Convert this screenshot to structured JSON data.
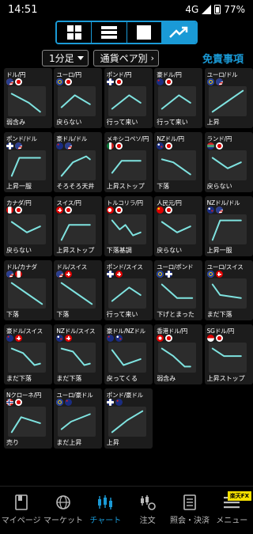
{
  "statusbar": {
    "time": "14:51",
    "network": "4G",
    "battery": "77%"
  },
  "filters": {
    "timeframe": "1分足",
    "sort": "通貨ペア別",
    "notes_label": "免責事項"
  },
  "colors": {
    "accent": "#1a9ad6",
    "line": "#7fe3e0",
    "card": "#1c1c1c",
    "chart_bg": "#2c2c2c"
  },
  "pairs": [
    {
      "name": "ドル/円",
      "flags": [
        "us",
        "jp"
      ],
      "status": "弱含み",
      "trend": [
        [
          0.1,
          0.25
        ],
        [
          0.55,
          0.55
        ],
        [
          0.85,
          0.85
        ]
      ]
    },
    {
      "name": "ユーロ/円",
      "flags": [
        "eu",
        "jp"
      ],
      "status": "戻らない",
      "trend": [
        [
          0.1,
          0.7
        ],
        [
          0.45,
          0.3
        ],
        [
          0.85,
          0.6
        ]
      ]
    },
    {
      "name": "ポンド/円",
      "flags": [
        "gb",
        "jp"
      ],
      "status": "行って来い",
      "trend": [
        [
          0.1,
          0.75
        ],
        [
          0.55,
          0.3
        ],
        [
          0.85,
          0.55
        ]
      ]
    },
    {
      "name": "豪ドル/円",
      "flags": [
        "au",
        "jp"
      ],
      "status": "行って来い",
      "trend": [
        [
          0.1,
          0.75
        ],
        [
          0.55,
          0.3
        ],
        [
          0.85,
          0.55
        ]
      ]
    },
    {
      "name": "ユーロ/ドル",
      "flags": [
        "eu",
        "us"
      ],
      "status": "上昇",
      "trend": [
        [
          0.1,
          0.85
        ],
        [
          0.5,
          0.5
        ],
        [
          0.9,
          0.15
        ]
      ]
    },
    {
      "name": "ポンド/ドル",
      "flags": [
        "gb",
        "us"
      ],
      "status": "上昇一服",
      "trend": [
        [
          0.1,
          0.85
        ],
        [
          0.3,
          0.25
        ],
        [
          0.85,
          0.25
        ]
      ]
    },
    {
      "name": "豪ドル/ドル",
      "flags": [
        "au",
        "us"
      ],
      "status": "そろそろ天井",
      "trend": [
        [
          0.1,
          0.85
        ],
        [
          0.4,
          0.4
        ],
        [
          0.75,
          0.2
        ],
        [
          0.85,
          0.3
        ]
      ]
    },
    {
      "name": "メキシコペソ/円",
      "flags": [
        "mx",
        "jp"
      ],
      "status": "上昇ストップ",
      "trend": [
        [
          0.1,
          0.75
        ],
        [
          0.35,
          0.35
        ],
        [
          0.85,
          0.35
        ]
      ]
    },
    {
      "name": "NZドル/円",
      "flags": [
        "nz",
        "jp"
      ],
      "status": "下落",
      "trend": [
        [
          0.1,
          0.3
        ],
        [
          0.4,
          0.4
        ],
        [
          0.85,
          0.8
        ]
      ]
    },
    {
      "name": "ランド/円",
      "flags": [
        "za",
        "jp"
      ],
      "status": "戻らない",
      "trend": [
        [
          0.1,
          0.25
        ],
        [
          0.5,
          0.6
        ],
        [
          0.85,
          0.4
        ]
      ]
    },
    {
      "name": "カナダ/円",
      "flags": [
        "ca",
        "jp"
      ],
      "status": "戻らない",
      "trend": [
        [
          0.1,
          0.25
        ],
        [
          0.5,
          0.6
        ],
        [
          0.85,
          0.4
        ]
      ]
    },
    {
      "name": "スイス/円",
      "flags": [
        "ch",
        "jp"
      ],
      "status": "上昇ストップ",
      "trend": [
        [
          0.1,
          0.85
        ],
        [
          0.3,
          0.35
        ],
        [
          0.85,
          0.35
        ]
      ]
    },
    {
      "name": "トルコリラ/円",
      "flags": [
        "tr",
        "jp"
      ],
      "status": "下落基調",
      "trend": [
        [
          0.1,
          0.2
        ],
        [
          0.3,
          0.5
        ],
        [
          0.45,
          0.35
        ],
        [
          0.65,
          0.7
        ],
        [
          0.85,
          0.6
        ]
      ]
    },
    {
      "name": "人民元/円",
      "flags": [
        "cn",
        "jp"
      ],
      "status": "戻らない",
      "trend": [
        [
          0.1,
          0.25
        ],
        [
          0.5,
          0.6
        ],
        [
          0.85,
          0.4
        ]
      ]
    },
    {
      "name": "NZドル/ドル",
      "flags": [
        "nz",
        "us"
      ],
      "status": "上昇一服",
      "trend": [
        [
          0.1,
          0.85
        ],
        [
          0.3,
          0.2
        ],
        [
          0.85,
          0.2
        ]
      ]
    },
    {
      "name": "ドル/カナダ",
      "flags": [
        "us",
        "ca"
      ],
      "status": "下落",
      "trend": [
        [
          0.1,
          0.15
        ],
        [
          0.5,
          0.5
        ],
        [
          0.9,
          0.85
        ]
      ]
    },
    {
      "name": "ドル/スイス",
      "flags": [
        "us",
        "ch"
      ],
      "status": "下落",
      "trend": [
        [
          0.1,
          0.15
        ],
        [
          0.5,
          0.5
        ],
        [
          0.9,
          0.85
        ]
      ]
    },
    {
      "name": "ポンド/スイス",
      "flags": [
        "gb",
        "ch"
      ],
      "status": "行って来い",
      "trend": [
        [
          0.1,
          0.75
        ],
        [
          0.55,
          0.3
        ],
        [
          0.85,
          0.55
        ]
      ]
    },
    {
      "name": "ユーロ/ポンド",
      "flags": [
        "eu",
        "gb"
      ],
      "status": "下げとまった",
      "trend": [
        [
          0.1,
          0.2
        ],
        [
          0.5,
          0.65
        ],
        [
          0.9,
          0.65
        ]
      ]
    },
    {
      "name": "ユーロ/スイス",
      "flags": [
        "eu",
        "ch"
      ],
      "status": "まだ下落",
      "trend": [
        [
          0.1,
          0.2
        ],
        [
          0.3,
          0.55
        ],
        [
          0.85,
          0.65
        ]
      ]
    },
    {
      "name": "豪ドル/スイス",
      "flags": [
        "au",
        "ch"
      ],
      "status": "まだ下落",
      "trend": [
        [
          0.1,
          0.2
        ],
        [
          0.4,
          0.35
        ],
        [
          0.7,
          0.75
        ],
        [
          0.85,
          0.7
        ]
      ]
    },
    {
      "name": "NZドル/スイス",
      "flags": [
        "nz",
        "ch"
      ],
      "status": "まだ下落",
      "trend": [
        [
          0.1,
          0.2
        ],
        [
          0.4,
          0.3
        ],
        [
          0.7,
          0.75
        ],
        [
          0.85,
          0.7
        ]
      ]
    },
    {
      "name": "豪ドル/NZドル",
      "flags": [
        "au",
        "nz"
      ],
      "status": "戻ってくる",
      "trend": [
        [
          0.1,
          0.25
        ],
        [
          0.4,
          0.75
        ],
        [
          0.85,
          0.55
        ]
      ]
    },
    {
      "name": "香港ドル/円",
      "flags": [
        "hk",
        "jp"
      ],
      "status": "弱含み",
      "trend": [
        [
          0.1,
          0.2
        ],
        [
          0.4,
          0.45
        ],
        [
          0.7,
          0.8
        ],
        [
          0.85,
          0.8
        ]
      ]
    },
    {
      "name": "SGドル/円",
      "flags": [
        "sg",
        "jp"
      ],
      "status": "上昇ストップ",
      "trend": [
        [
          0.1,
          0.2
        ],
        [
          0.4,
          0.45
        ],
        [
          0.85,
          0.45
        ]
      ]
    },
    {
      "name": "Nクローネ/円",
      "flags": [
        "no",
        "jp"
      ],
      "status": "売り",
      "trend": [
        [
          0.1,
          0.85
        ],
        [
          0.35,
          0.35
        ],
        [
          0.85,
          0.55
        ]
      ]
    },
    {
      "name": "ユーロ/豪ドル",
      "flags": [
        "eu",
        "au"
      ],
      "status": "まだ上昇",
      "trend": [
        [
          0.1,
          0.75
        ],
        [
          0.35,
          0.5
        ],
        [
          0.85,
          0.25
        ]
      ]
    },
    {
      "name": "ポンド/豪ドル",
      "flags": [
        "gb",
        "au"
      ],
      "status": "上昇",
      "trend": [
        [
          0.1,
          0.85
        ],
        [
          0.5,
          0.45
        ],
        [
          0.9,
          0.15
        ]
      ]
    }
  ],
  "nav": [
    {
      "label": "マイページ",
      "icon": "mypage-icon"
    },
    {
      "label": "マーケット",
      "icon": "market-icon"
    },
    {
      "label": "チャート",
      "icon": "chart-icon",
      "active": true
    },
    {
      "label": "注文",
      "icon": "order-icon"
    },
    {
      "label": "照会・決済",
      "icon": "inquiry-icon"
    },
    {
      "label": "メニュー",
      "icon": "menu-icon",
      "badge": "楽天FX"
    }
  ]
}
